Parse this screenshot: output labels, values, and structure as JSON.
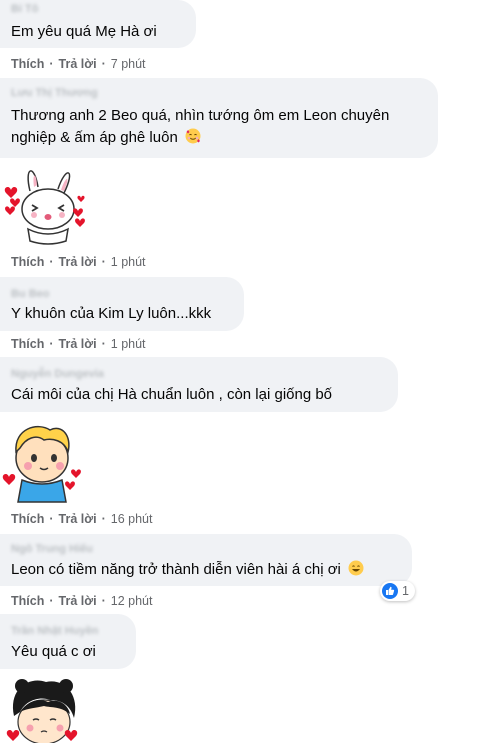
{
  "comments": [
    {
      "author": "Bi Tô",
      "text": "Em yêu quá Mẹ Hà ơi",
      "like": "Thích",
      "reply": "Trả lời",
      "time": "7 phút"
    },
    {
      "author": "Lưu Thị Thương",
      "text_line1": "Thương anh 2 Beo quá, nhìn tướng ôm em Leon chuyên",
      "text_line2": "nghiệp & ấm áp ghê luôn",
      "emoji": "smiling-face-with-hearts",
      "sticker": "bunny-heart-sticker",
      "like": "Thích",
      "reply": "Trả lời",
      "time": "1 phút"
    },
    {
      "author": "Bu Beo",
      "text": "Y khuôn của Kim Ly luôn...kkk",
      "like": "Thích",
      "reply": "Trả lời",
      "time": "1 phút"
    },
    {
      "author": "Nguyễn Dungevia",
      "text": "Cái môi của chị Hà chuẩn luôn , còn lại giống bố",
      "sticker": "blond-boy-heart-sticker",
      "like": "Thích",
      "reply": "Trả lời",
      "time": "16 phút"
    },
    {
      "author": "Ngô Trung Hiếu",
      "text": "Leon có tiềm năng trở thành diễn viên hài á chị ơi",
      "emoji": "grinning-face",
      "reaction_icon": "like-icon",
      "reaction_count": "1",
      "like": "Thích",
      "reply": "Trả lời",
      "time": "12 phút"
    },
    {
      "author": "Trần Nhật Huyền",
      "text": "Yêu quá c ơi",
      "sticker": "girl-heart-sticker"
    }
  ],
  "colors": {
    "bubble": "#f0f2f5",
    "meta": "#65676b",
    "text": "#050505",
    "like_blue": "#1877f2"
  }
}
